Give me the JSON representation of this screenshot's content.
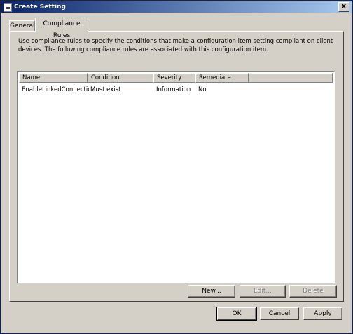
{
  "window": {
    "title": "Create Setting",
    "close_label": "X"
  },
  "tabs": [
    {
      "label": "General",
      "active": false
    },
    {
      "label": "Compliance Rules",
      "active": true
    }
  ],
  "description": "Use compliance rules to specify the conditions that make a configuration item setting compliant on client devices. The following compliance rules are associated with this configuration item.",
  "rules_table": {
    "columns": [
      "Name",
      "Condition",
      "Severity",
      "Remediate"
    ],
    "rows": [
      [
        "EnableLinkedConnectio...",
        "Must exist",
        "Information",
        "No"
      ]
    ]
  },
  "rule_buttons": {
    "new": "New...",
    "edit": "Edit...",
    "delete": "Delete"
  },
  "dialog_buttons": {
    "ok": "OK",
    "cancel": "Cancel",
    "apply": "Apply"
  }
}
